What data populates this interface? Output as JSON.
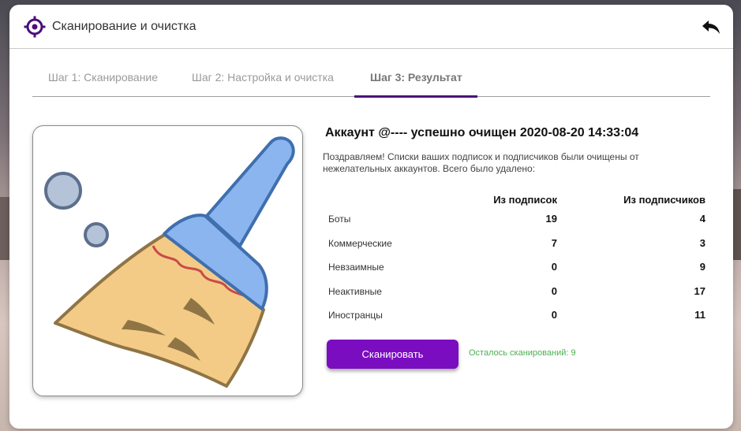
{
  "header": {
    "title": "Сканирование и очистка",
    "accent_color": "#4b0f7a",
    "icons": [
      "target-icon",
      "back-arrow-icon"
    ]
  },
  "tabs": [
    {
      "label": "Шаг 1: Сканирование",
      "active": false
    },
    {
      "label": "Шаг 2: Настройка и очистка",
      "active": false
    },
    {
      "label": "Шаг 3: Результат",
      "active": true
    }
  ],
  "illustration": {
    "icon": "broom-icon"
  },
  "result": {
    "title": "Аккаунт @---- успешно очищен 2020-08-20 14:33:04",
    "description": "Поздравляем! Списки ваших подписок и подписчиков были очищены от нежелательных аккаунтов. Всего было удалено:"
  },
  "stats": {
    "col1_header": "Из подписок",
    "col2_header": "Из подписчиков",
    "rows": [
      {
        "label": "Боты",
        "from_following": "19",
        "from_followers": "4"
      },
      {
        "label": "Коммерческие",
        "from_following": "7",
        "from_followers": "3"
      },
      {
        "label": "Невзаимные",
        "from_following": "0",
        "from_followers": "9"
      },
      {
        "label": "Неактивные",
        "from_following": "0",
        "from_followers": "17"
      },
      {
        "label": "Иностранцы",
        "from_following": "0",
        "from_followers": "11"
      }
    ]
  },
  "actions": {
    "scan_label": "Сканировать",
    "scan_color": "#7b0dc0",
    "remaining_text": "Осталось сканирований: 9",
    "remaining_color": "#4caf50"
  }
}
